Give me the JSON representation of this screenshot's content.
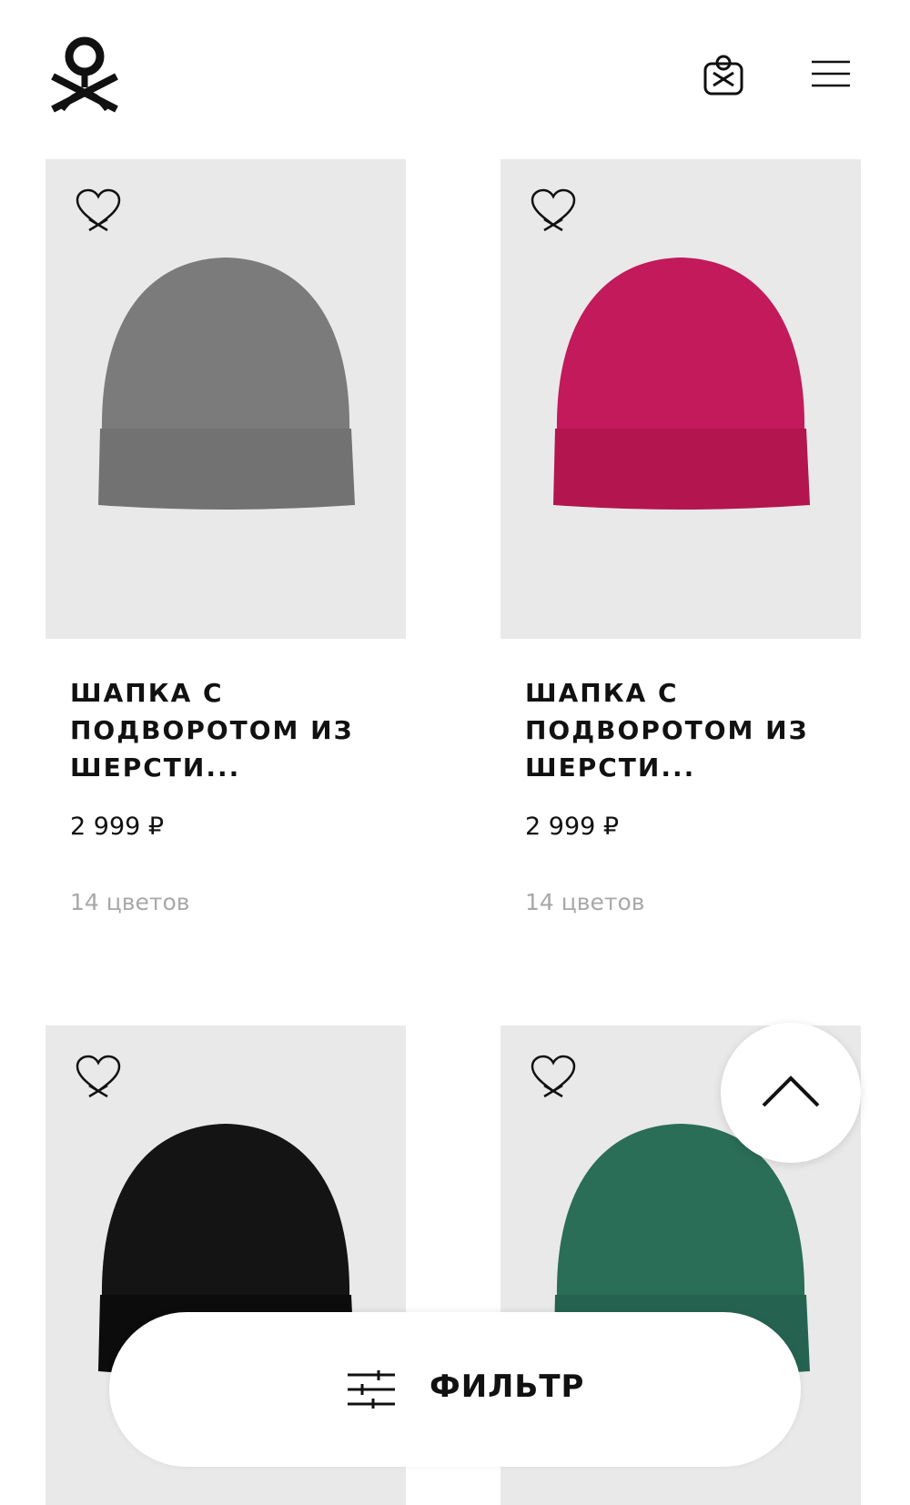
{
  "header": {
    "logo_icon": "benetton-logo-icon",
    "bag_icon": "shopping-bag-icon",
    "menu_icon": "hamburger-menu-icon"
  },
  "products": [
    {
      "title": "ШАПКА С ПОДВОРОТОМ ИЗ ШЕРСТИ...",
      "price": "2 999 ₽",
      "colors": "14 цветов",
      "hat_color": "#7b7b7b",
      "cuff_color": "#727272"
    },
    {
      "title": "ШАПКА С ПОДВОРОТОМ ИЗ ШЕРСТИ...",
      "price": "2 999 ₽",
      "colors": "14 цветов",
      "hat_color": "#c21a5a",
      "cuff_color": "#b3154f"
    },
    {
      "hat_color": "#141414",
      "cuff_color": "#0c0c0c"
    },
    {
      "hat_color": "#2a6e57",
      "cuff_color": "#256350"
    }
  ],
  "scroll_top_icon": "chevron-up-icon",
  "filter": {
    "label": "ФИЛЬТР",
    "icon": "sliders-icon"
  }
}
